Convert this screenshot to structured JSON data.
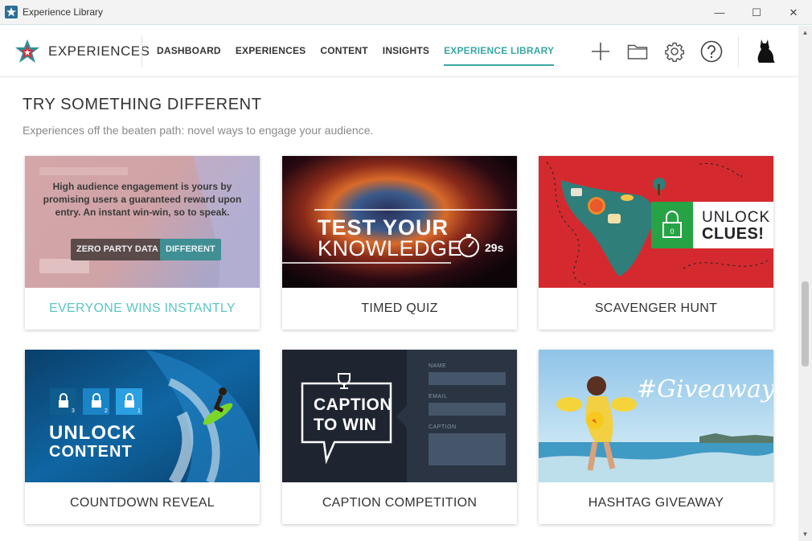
{
  "window": {
    "title": "Experience Library",
    "minimize": "—",
    "maximize": "☐",
    "close": "✕"
  },
  "brand": {
    "name": "EXPERIENCES"
  },
  "nav": [
    {
      "label": "DASHBOARD",
      "active": false
    },
    {
      "label": "EXPERIENCES",
      "active": false
    },
    {
      "label": "CONTENT",
      "active": false
    },
    {
      "label": "INSIGHTS",
      "active": false
    },
    {
      "label": "EXPERIENCE LIBRARY",
      "active": true
    }
  ],
  "tools": [
    "plus-icon",
    "folder-icon",
    "gear-icon",
    "help-icon",
    "cat-avatar-icon"
  ],
  "section": {
    "title": "TRY SOMETHING DIFFERENT",
    "subtitle": "Experiences off the beaten path: novel ways to engage your audience."
  },
  "cards": [
    {
      "label": "EVERYONE WINS INSTANTLY",
      "hover_description": "High audience engagement is yours by promising users a guaranteed reward upon entry. An instant win-win, so to speak.",
      "tags": [
        "ZERO PARTY DATA",
        "DIFFERENT"
      ]
    },
    {
      "label": "TIMED QUIZ",
      "art": {
        "line1": "TEST YOUR",
        "line2": "KNOWLEDGE",
        "timer": "29s"
      }
    },
    {
      "label": "SCAVENGER HUNT",
      "art": {
        "line1": "UNLOCK",
        "line2": "CLUES!",
        "lock_number": "0"
      }
    },
    {
      "label": "COUNTDOWN REVEAL",
      "art": {
        "line1": "UNLOCK",
        "line2": "CONTENT",
        "locks": [
          "3",
          "2",
          "1"
        ]
      }
    },
    {
      "label": "CAPTION COMPETITION",
      "art": {
        "line1": "CAPTION",
        "line2": "TO WIN",
        "fields": [
          "NAME",
          "EMAIL",
          "CAPTION"
        ]
      }
    },
    {
      "label": "HASHTAG GIVEAWAY",
      "art": {
        "hashtag": "#Giveaway"
      }
    }
  ],
  "colors": {
    "accent": "#3aa6a6",
    "scavenger_red": "#d42a2f",
    "unlock_green": "#27a346"
  }
}
